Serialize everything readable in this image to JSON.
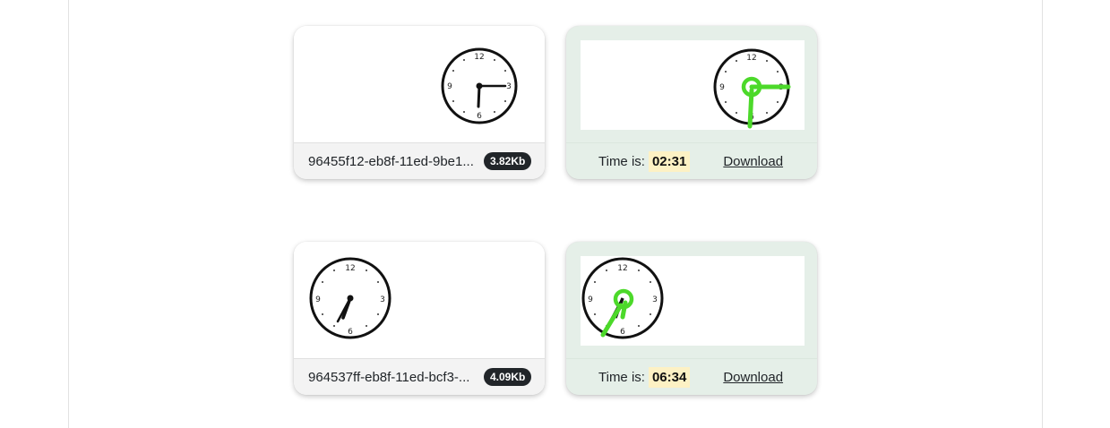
{
  "cards": [
    {
      "file": {
        "name": "96455f12-eb8f-11ed-9be1...",
        "size": "3.82Kb"
      },
      "result": {
        "time_label": "Time is:",
        "time_value": "02:31",
        "download_label": "Download"
      }
    },
    {
      "file": {
        "name": "964537ff-eb8f-11ed-bcf3-...",
        "size": "4.09Kb"
      },
      "result": {
        "time_label": "Time is:",
        "time_value": "06:34",
        "download_label": "Download"
      }
    }
  ],
  "clock": {
    "numerals": [
      "12",
      "3",
      "6",
      "9"
    ]
  },
  "colors": {
    "highlight": "#4cd92a",
    "badge": "#212529",
    "result_bg": "#e5efe8",
    "time_bg": "#fdf1c4"
  }
}
